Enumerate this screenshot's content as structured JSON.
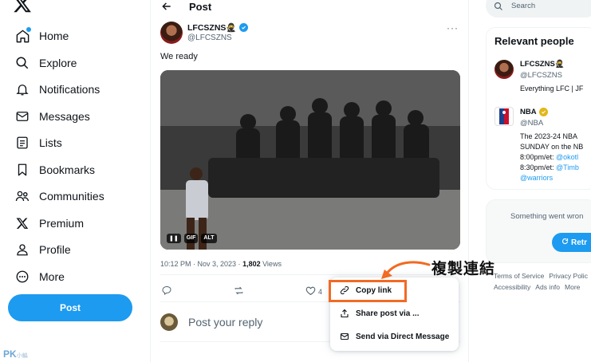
{
  "nav": {
    "items": [
      {
        "label": "Home",
        "icon": "home-icon"
      },
      {
        "label": "Explore",
        "icon": "search-icon"
      },
      {
        "label": "Notifications",
        "icon": "bell-icon"
      },
      {
        "label": "Messages",
        "icon": "envelope-icon"
      },
      {
        "label": "Lists",
        "icon": "list-icon"
      },
      {
        "label": "Bookmarks",
        "icon": "bookmark-icon"
      },
      {
        "label": "Communities",
        "icon": "people-icon"
      },
      {
        "label": "Premium",
        "icon": "x-logo-icon"
      },
      {
        "label": "Profile",
        "icon": "person-icon"
      },
      {
        "label": "More",
        "icon": "more-circle-icon"
      }
    ],
    "post_label": "Post"
  },
  "header": {
    "title": "Post"
  },
  "tweet": {
    "author_name": "LFCSZNS🥷",
    "author_handle": "@LFCSZNS",
    "text": "We ready",
    "media_controls": {
      "gif": "GIF",
      "alt": "ALT"
    },
    "timestamp": "10:12 PM · Nov 3, 2023 · ",
    "views_count": "1,802",
    "views_label": " Views",
    "like_count": "4"
  },
  "reply": {
    "placeholder": "Post your reply"
  },
  "menu": {
    "items": [
      {
        "label": "Copy link",
        "icon": "link-icon"
      },
      {
        "label": "Share post via ...",
        "icon": "share-icon"
      },
      {
        "label": "Send via Direct Message",
        "icon": "envelope-icon"
      }
    ]
  },
  "annotation": {
    "text": "複製連結",
    "color": "#f26a24"
  },
  "right": {
    "search_placeholder": "Search",
    "relevant_title": "Relevant people",
    "people": [
      {
        "name": "LFCSZNS🥷",
        "handle": "@LFCSZNS",
        "bio": [
          "Everything LFC | JF"
        ]
      },
      {
        "name": "NBA",
        "handle": "@NBA",
        "bio": [
          "The 2023-24 NBA",
          "SUNDAY on the NB",
          "8:00pm/et: ",
          "8:30pm/et: ",
          "@warriors"
        ],
        "links": [
          "@okotl",
          "@Timb"
        ]
      }
    ],
    "error_text": "Something went wron",
    "retry_label": "Retr",
    "footer_line1": [
      "Terms of Service",
      "Privacy Polic"
    ],
    "footer_line2": [
      "Accessibility",
      "Ads info",
      "More"
    ]
  },
  "watermark": {
    "text": "PK",
    "sub": "小編"
  },
  "colors": {
    "accent": "#1d9bf0",
    "highlight": "#f26a24",
    "text": "#0f1419",
    "muted": "#536471"
  }
}
